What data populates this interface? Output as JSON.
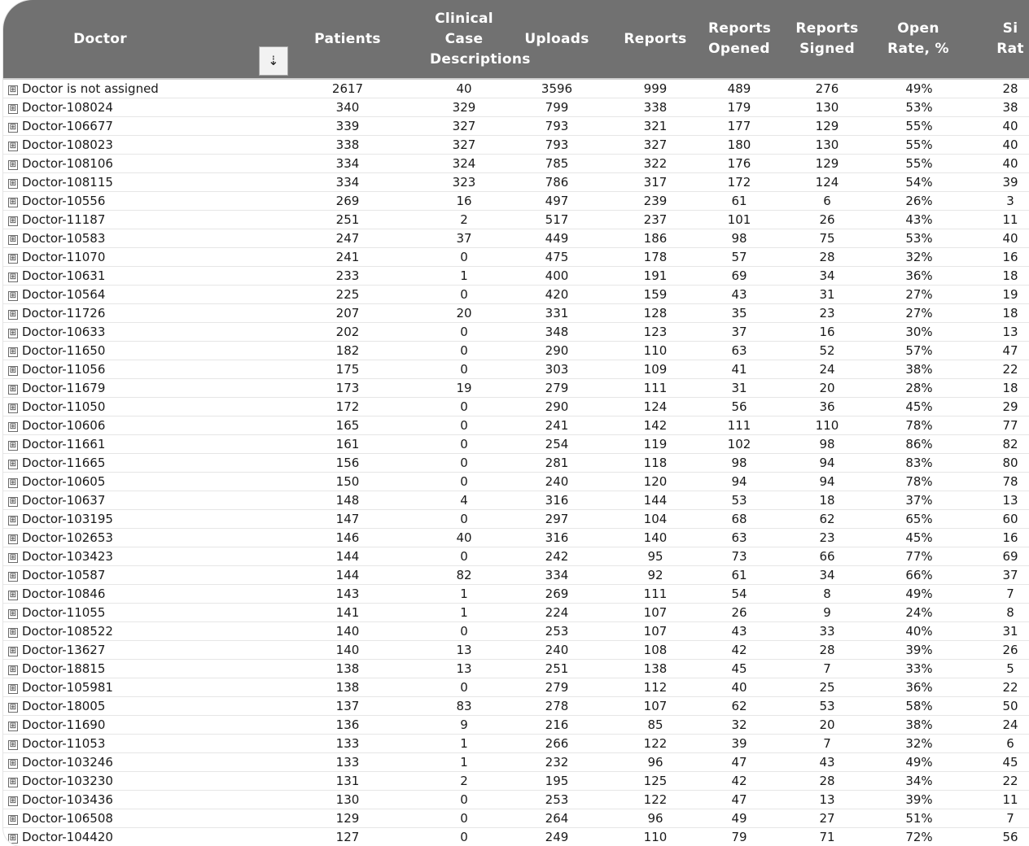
{
  "table": {
    "columns": [
      "Doctor",
      "Patients",
      "Clinical Case\nDescriptions",
      "Uploads",
      "Reports",
      "Reports\nOpened",
      "Reports\nSigned",
      "Open\nRate, %",
      "Si\nRat"
    ],
    "sort_icon": "sort-descending-icon",
    "expand_glyph": "⊞",
    "rows": [
      [
        "Doctor is not assigned",
        "2617",
        "40",
        "3596",
        "999",
        "489",
        "276",
        "49%",
        "28"
      ],
      [
        "Doctor-108024",
        "340",
        "329",
        "799",
        "338",
        "179",
        "130",
        "53%",
        "38"
      ],
      [
        "Doctor-106677",
        "339",
        "327",
        "793",
        "321",
        "177",
        "129",
        "55%",
        "40"
      ],
      [
        "Doctor-108023",
        "338",
        "327",
        "793",
        "327",
        "180",
        "130",
        "55%",
        "40"
      ],
      [
        "Doctor-108106",
        "334",
        "324",
        "785",
        "322",
        "176",
        "129",
        "55%",
        "40"
      ],
      [
        "Doctor-108115",
        "334",
        "323",
        "786",
        "317",
        "172",
        "124",
        "54%",
        "39"
      ],
      [
        "Doctor-10556",
        "269",
        "16",
        "497",
        "239",
        "61",
        "6",
        "26%",
        "3"
      ],
      [
        "Doctor-11187",
        "251",
        "2",
        "517",
        "237",
        "101",
        "26",
        "43%",
        "11"
      ],
      [
        "Doctor-10583",
        "247",
        "37",
        "449",
        "186",
        "98",
        "75",
        "53%",
        "40"
      ],
      [
        "Doctor-11070",
        "241",
        "0",
        "475",
        "178",
        "57",
        "28",
        "32%",
        "16"
      ],
      [
        "Doctor-10631",
        "233",
        "1",
        "400",
        "191",
        "69",
        "34",
        "36%",
        "18"
      ],
      [
        "Doctor-10564",
        "225",
        "0",
        "420",
        "159",
        "43",
        "31",
        "27%",
        "19"
      ],
      [
        "Doctor-11726",
        "207",
        "20",
        "331",
        "128",
        "35",
        "23",
        "27%",
        "18"
      ],
      [
        "Doctor-10633",
        "202",
        "0",
        "348",
        "123",
        "37",
        "16",
        "30%",
        "13"
      ],
      [
        "Doctor-11650",
        "182",
        "0",
        "290",
        "110",
        "63",
        "52",
        "57%",
        "47"
      ],
      [
        "Doctor-11056",
        "175",
        "0",
        "303",
        "109",
        "41",
        "24",
        "38%",
        "22"
      ],
      [
        "Doctor-11679",
        "173",
        "19",
        "279",
        "111",
        "31",
        "20",
        "28%",
        "18"
      ],
      [
        "Doctor-11050",
        "172",
        "0",
        "290",
        "124",
        "56",
        "36",
        "45%",
        "29"
      ],
      [
        "Doctor-10606",
        "165",
        "0",
        "241",
        "142",
        "111",
        "110",
        "78%",
        "77"
      ],
      [
        "Doctor-11661",
        "161",
        "0",
        "254",
        "119",
        "102",
        "98",
        "86%",
        "82"
      ],
      [
        "Doctor-11665",
        "156",
        "0",
        "281",
        "118",
        "98",
        "94",
        "83%",
        "80"
      ],
      [
        "Doctor-10605",
        "150",
        "0",
        "240",
        "120",
        "94",
        "94",
        "78%",
        "78"
      ],
      [
        "Doctor-10637",
        "148",
        "4",
        "316",
        "144",
        "53",
        "18",
        "37%",
        "13"
      ],
      [
        "Doctor-103195",
        "147",
        "0",
        "297",
        "104",
        "68",
        "62",
        "65%",
        "60"
      ],
      [
        "Doctor-102653",
        "146",
        "40",
        "316",
        "140",
        "63",
        "23",
        "45%",
        "16"
      ],
      [
        "Doctor-103423",
        "144",
        "0",
        "242",
        "95",
        "73",
        "66",
        "77%",
        "69"
      ],
      [
        "Doctor-10587",
        "144",
        "82",
        "334",
        "92",
        "61",
        "34",
        "66%",
        "37"
      ],
      [
        "Doctor-10846",
        "143",
        "1",
        "269",
        "111",
        "54",
        "8",
        "49%",
        "7"
      ],
      [
        "Doctor-11055",
        "141",
        "1",
        "224",
        "107",
        "26",
        "9",
        "24%",
        "8"
      ],
      [
        "Doctor-108522",
        "140",
        "0",
        "253",
        "107",
        "43",
        "33",
        "40%",
        "31"
      ],
      [
        "Doctor-13627",
        "140",
        "13",
        "240",
        "108",
        "42",
        "28",
        "39%",
        "26"
      ],
      [
        "Doctor-18815",
        "138",
        "13",
        "251",
        "138",
        "45",
        "7",
        "33%",
        "5"
      ],
      [
        "Doctor-105981",
        "138",
        "0",
        "279",
        "112",
        "40",
        "25",
        "36%",
        "22"
      ],
      [
        "Doctor-18005",
        "137",
        "83",
        "278",
        "107",
        "62",
        "53",
        "58%",
        "50"
      ],
      [
        "Doctor-11690",
        "136",
        "9",
        "216",
        "85",
        "32",
        "20",
        "38%",
        "24"
      ],
      [
        "Doctor-11053",
        "133",
        "1",
        "266",
        "122",
        "39",
        "7",
        "32%",
        "6"
      ],
      [
        "Doctor-103246",
        "133",
        "1",
        "232",
        "96",
        "47",
        "43",
        "49%",
        "45"
      ],
      [
        "Doctor-103230",
        "131",
        "2",
        "195",
        "125",
        "42",
        "28",
        "34%",
        "22"
      ],
      [
        "Doctor-103436",
        "130",
        "0",
        "253",
        "122",
        "47",
        "13",
        "39%",
        "11"
      ],
      [
        "Doctor-106508",
        "129",
        "0",
        "264",
        "96",
        "49",
        "27",
        "51%",
        "7"
      ],
      [
        "Doctor-104420",
        "127",
        "0",
        "249",
        "110",
        "79",
        "71",
        "72%",
        "56"
      ]
    ]
  }
}
